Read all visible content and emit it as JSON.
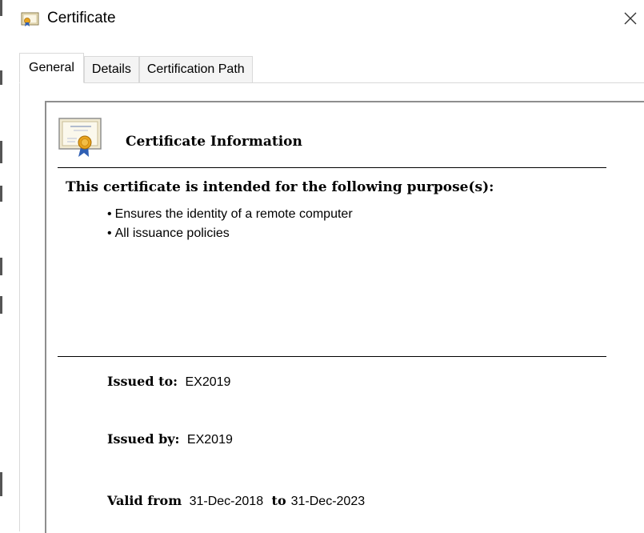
{
  "window": {
    "title": "Certificate",
    "title_icon": "certificate-icon",
    "close_glyph": "✕",
    "close_icon": "close-icon"
  },
  "tabs": [
    {
      "label": "General",
      "active": true
    },
    {
      "label": "Details",
      "active": false
    },
    {
      "label": "Certification Path",
      "active": false
    }
  ],
  "general": {
    "info_icon": "certificate-seal-icon",
    "heading": "Certificate Information",
    "purpose_heading": "This certificate is intended for the following purpose(s):",
    "purposes": [
      "Ensures the identity of a remote computer",
      "All issuance policies"
    ],
    "issued_to_label": "Issued to:",
    "issued_to_value": "EX2019",
    "issued_by_label": "Issued by:",
    "issued_by_value": "EX2019",
    "valid_from_label": "Valid from",
    "valid_from_value": "31-Dec-2018",
    "valid_to_label": "to",
    "valid_to_value": "31-Dec-2023"
  },
  "colors": {
    "accent_gold": "#e8a21c",
    "ribbon_blue": "#2f5fb3",
    "tab_border": "#d9d9d9",
    "frame_border": "#8e8e8e"
  }
}
